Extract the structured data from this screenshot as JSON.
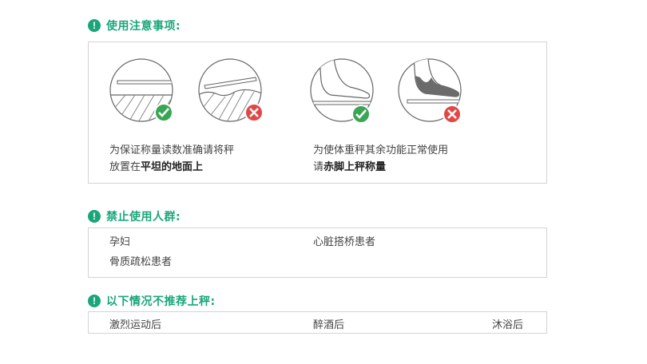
{
  "sections": [
    {
      "title": "使用注意事项:"
    },
    {
      "title": "禁止使用人群:"
    },
    {
      "title": "以下情况不推荐上秤:"
    }
  ],
  "notice": {
    "left_line1": "为保证称量读数准确请将秤",
    "left_line2_prefix": "放置在",
    "left_line2_bold": "平坦的地面上",
    "right_line1": "为使体重秤其余功能正常使用",
    "right_line2_prefix": "请",
    "right_line2_bold": "赤脚上秤称量",
    "icons": [
      "flat-floor-ok",
      "uneven-floor-no",
      "barefoot-ok",
      "sock-foot-no"
    ],
    "colors": {
      "ok": "#3aa655",
      "no": "#e04848"
    }
  },
  "forbidden": {
    "items": [
      "孕妇",
      "心脏搭桥患者",
      "骨质疏松患者"
    ]
  },
  "not_recommended": {
    "items": [
      "激烈运动后",
      "醉酒后",
      "沐浴后"
    ]
  },
  "theme": {
    "accent": "#1aa67a",
    "border": "#d4d4d4"
  }
}
